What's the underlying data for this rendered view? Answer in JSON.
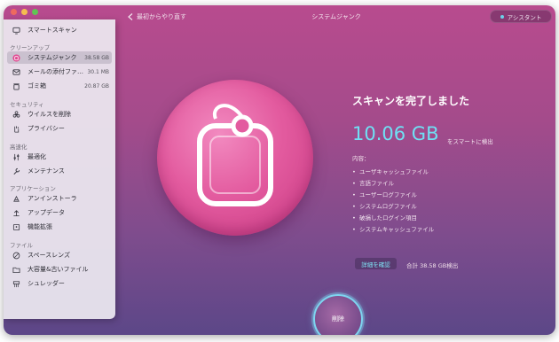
{
  "header": {
    "back_label": "最初からやり直す",
    "title": "システムジャンク",
    "assistant_label": "アシスタント"
  },
  "sidebar": {
    "items": [
      {
        "label": "スマートスキャン",
        "icon": "monitor-icon"
      },
      {
        "section": "クリーンアップ"
      },
      {
        "label": "システムジャンク",
        "size": "38.58 GB",
        "icon": "system-junk-icon",
        "active": true
      },
      {
        "label": "メールの添付ファ…",
        "size": "30.1 MB",
        "icon": "mail-icon"
      },
      {
        "label": "ゴミ箱",
        "size": "20.87 GB",
        "icon": "trash-icon"
      },
      {
        "section": "セキュリティ"
      },
      {
        "label": "ウイルスを削除",
        "icon": "biohazard-icon"
      },
      {
        "label": "プライバシー",
        "icon": "hand-icon"
      },
      {
        "section": "高速化"
      },
      {
        "label": "最適化",
        "icon": "sliders-icon"
      },
      {
        "label": "メンテナンス",
        "icon": "wrench-icon"
      },
      {
        "section": "アプリケーション"
      },
      {
        "label": "アンインストーラ",
        "icon": "uninstaller-icon"
      },
      {
        "label": "アップデータ",
        "icon": "updater-icon"
      },
      {
        "label": "機能拡張",
        "icon": "extensions-icon"
      },
      {
        "section": "ファイル"
      },
      {
        "label": "スペースレンズ",
        "icon": "space-lens-icon"
      },
      {
        "label": "大容量&古いファイル",
        "icon": "folder-icon"
      },
      {
        "label": "シュレッダー",
        "icon": "shredder-icon"
      }
    ]
  },
  "main": {
    "headline": "スキャンを完了しました",
    "size_value": "10.06 GB",
    "size_suffix": "をスマートに検出",
    "contents_label": "内容：",
    "categories": [
      "ユーザキャッシュファイル",
      "言語ファイル",
      "ユーザーログファイル",
      "システムログファイル",
      "破損したログイン項目",
      "システムキャッシュファイル"
    ],
    "review_button": "詳細を確認",
    "total_text": "合計 38.58 GB検出",
    "clean_button": "削除"
  },
  "colors": {
    "accent": "#6fe0f4",
    "window_top": "#b84b8e",
    "window_bottom": "#5c4788"
  }
}
